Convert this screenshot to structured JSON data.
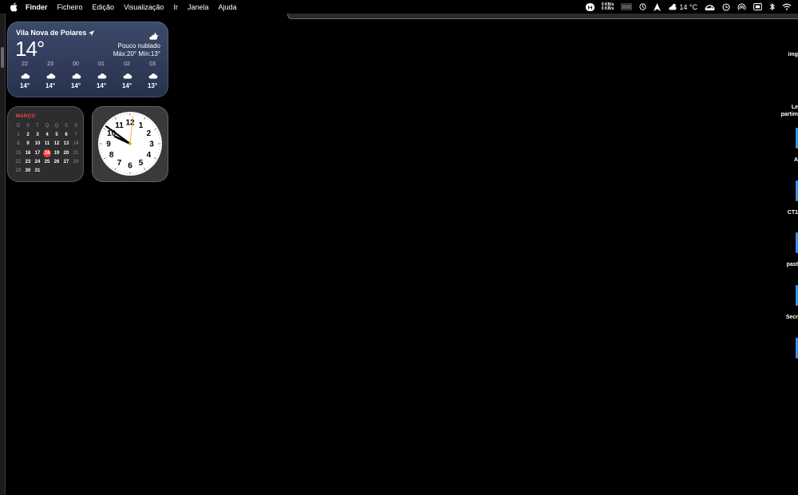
{
  "menubar": {
    "app_name": "Finder",
    "items": [
      "Ficheiro",
      "Edição",
      "Visualização",
      "Ir",
      "Janela",
      "Ajuda"
    ],
    "tray": {
      "net_up": "0 KB/s",
      "net_down": "0 KB/s",
      "weather_temp": "14 °C"
    }
  },
  "weather_widget": {
    "location": "Vila Nova de Poiares",
    "current_temp": "14°",
    "condition": "Pouco nublado",
    "high_low": "Máx:20° Mín:13°",
    "hours": [
      {
        "time": "22",
        "temp": "14°",
        "icon": "cloud-icon"
      },
      {
        "time": "23",
        "temp": "14°",
        "icon": "cloud-icon"
      },
      {
        "time": "00",
        "temp": "14°",
        "icon": "cloud-icon"
      },
      {
        "time": "01",
        "temp": "14°",
        "icon": "cloud-icon"
      },
      {
        "time": "02",
        "temp": "14°",
        "icon": "cloud-icon"
      },
      {
        "time": "03",
        "temp": "13°",
        "icon": "cloud-icon"
      }
    ]
  },
  "calendar_widget": {
    "month": "MARÇO",
    "weekdays": [
      "D",
      "S",
      "T",
      "Q",
      "Q",
      "S",
      "S"
    ],
    "today": "18",
    "accent": "#ff3b30"
  },
  "clock_widget": {
    "numerals": [
      "12",
      "1",
      "2",
      "3",
      "4",
      "5",
      "6",
      "7",
      "8",
      "9",
      "10",
      "11"
    ],
    "time": "21:51"
  },
  "desktop_items": [
    {
      "label": "img"
    },
    {
      "label": "Le"
    },
    {
      "label": "partim"
    },
    {
      "label": "A"
    },
    {
      "label": "CT1"
    },
    {
      "label": "past"
    },
    {
      "label": "Secr"
    }
  ]
}
